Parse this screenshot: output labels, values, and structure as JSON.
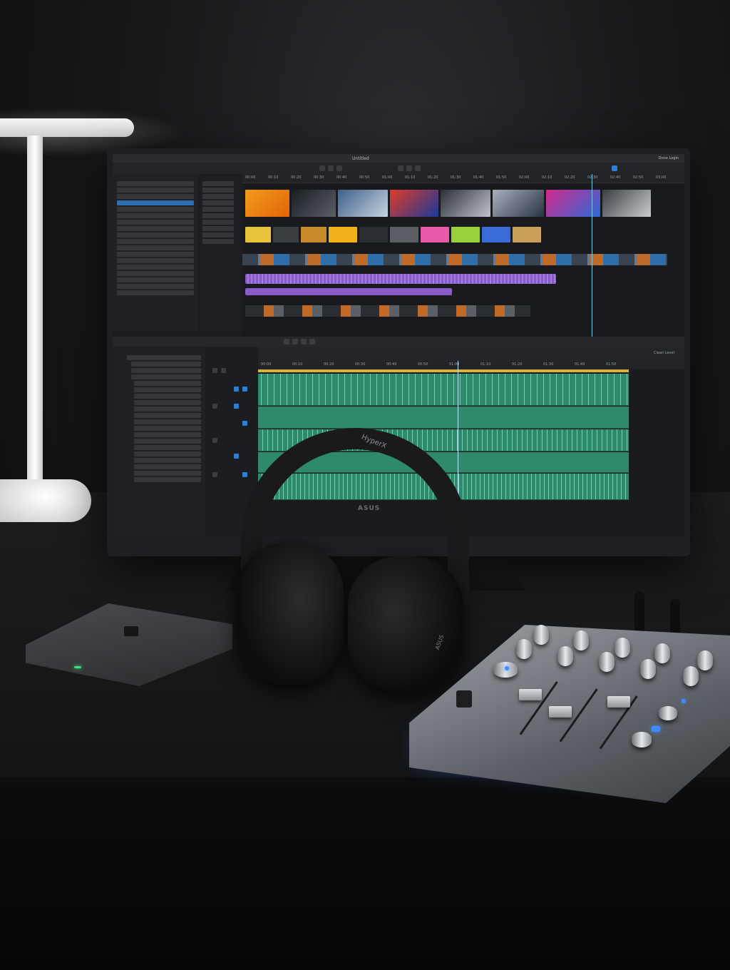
{
  "app": {
    "window_title": "Untitled",
    "status_right": "Done Login"
  },
  "video_ruler": [
    "00:00",
    "00:10",
    "00:20",
    "00:30",
    "00:40",
    "00:50",
    "01:00",
    "01:10",
    "01:20",
    "01:30",
    "01:40",
    "01:50",
    "02:00",
    "02:10",
    "02:20",
    "02:30",
    "02:40",
    "02:50",
    "03:00"
  ],
  "audio_ruler": [
    "00:00",
    "00:10",
    "00:20",
    "00:30",
    "00:40",
    "00:50",
    "01:00",
    "01:10",
    "01:20",
    "01:30",
    "01:40",
    "01:50"
  ],
  "audio_header_right": "Clean Level",
  "hardware": {
    "monitor_brand": "ASUS",
    "headphone_brand": "HyperX",
    "headphone_side": "ASUS"
  },
  "colors": {
    "accent_blue": "#2f7fd0",
    "audio_green": "#2f8a6c",
    "purple_track": "#8a5cc7",
    "mixer_glow": "#2d7bff"
  }
}
